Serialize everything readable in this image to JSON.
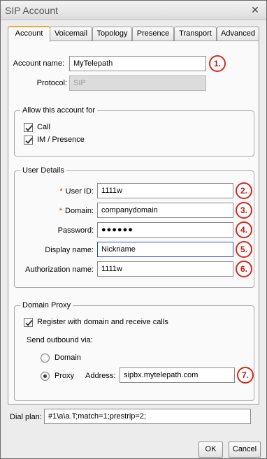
{
  "window": {
    "title": "SIP Account",
    "close_glyph": "✕"
  },
  "tabs": [
    {
      "label": "Account",
      "active": true
    },
    {
      "label": "Voicemail"
    },
    {
      "label": "Topology"
    },
    {
      "label": "Presence"
    },
    {
      "label": "Transport"
    },
    {
      "label": "Advanced"
    }
  ],
  "account": {
    "name_label": "Account name:",
    "name_value": "MyTelepath",
    "protocol_label": "Protocol:",
    "protocol_value": "SIP"
  },
  "allow": {
    "title": "Allow this account for",
    "call_label": "Call",
    "call_checked": true,
    "im_label": "IM / Presence",
    "im_checked": true
  },
  "user_details": {
    "title": "User Details",
    "required_mark": "*",
    "user_id_label": "User ID:",
    "user_id_value": "1111w",
    "domain_label": "Domain:",
    "domain_value": "companydomain",
    "password_label": "Password:",
    "password_value": "●●●●●●",
    "display_name_label": "Display name:",
    "display_name_value": "Nickname",
    "auth_name_label": "Authorization name:",
    "auth_name_value": "1111w"
  },
  "domain_proxy": {
    "title": "Domain Proxy",
    "register_label": "Register with domain and receive calls",
    "register_checked": true,
    "send_outbound_label": "Send outbound via:",
    "domain_option": "Domain",
    "proxy_option": "Proxy",
    "selected": "Proxy",
    "address_label": "Address:",
    "address_value": "sipbx.mytelepath.com"
  },
  "dial_plan": {
    "label": "Dial plan:",
    "value": "#1\\a\\a.T;match=1;prestrip=2;"
  },
  "badges": [
    "1.",
    "2.",
    "3.",
    "4.",
    "5.",
    "6.",
    "7."
  ],
  "buttons": {
    "ok": "OK",
    "cancel": "Cancel"
  },
  "colors": {
    "badge_red": "#d9261c",
    "active_tab_accent": "#f5a623",
    "focus_border": "#2e52c8"
  }
}
